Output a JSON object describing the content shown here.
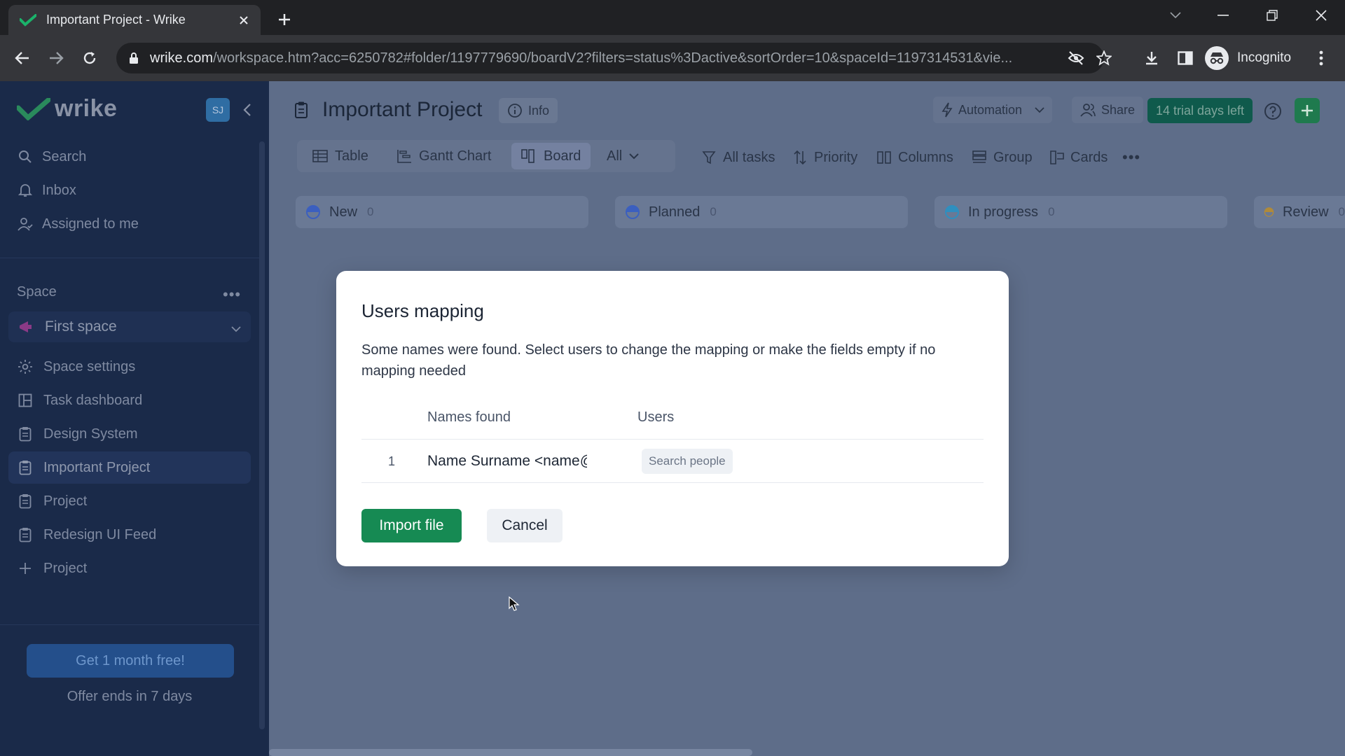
{
  "browser": {
    "tab_title": "Important Project - Wrike",
    "url_host": "wrike.com",
    "url_path": "/workspace.htm?acc=6250782#folder/1197779690/boardV2?filters=status%3Dactive&sortOrder=10&spaceId=1197314531&vie...",
    "profile_label": "Incognito"
  },
  "sidebar": {
    "logo_text": "wrike",
    "avatar_initials": "SJ",
    "nav": [
      {
        "label": "Search",
        "icon": "search-icon"
      },
      {
        "label": "Inbox",
        "icon": "bell-icon"
      },
      {
        "label": "Assigned to me",
        "icon": "user-icon"
      }
    ],
    "space_label": "Space",
    "space_more": "•••",
    "space_selected": "First space",
    "space_items": [
      {
        "label": "Space settings",
        "icon": "gear-icon"
      },
      {
        "label": "Task dashboard",
        "icon": "dashboard-icon"
      },
      {
        "label": "Design System",
        "icon": "project-icon"
      },
      {
        "label": "Important Project",
        "icon": "project-icon",
        "active": true
      },
      {
        "label": "Project",
        "icon": "project-icon"
      },
      {
        "label": "Redesign UI Feed",
        "icon": "project-icon"
      },
      {
        "label": "Project",
        "icon": "plus-icon"
      }
    ],
    "promo_button": "Get 1 month free!",
    "offer_text": "Offer ends in 7 days"
  },
  "header": {
    "title": "Important Project",
    "info_label": "Info",
    "automation_label": "Automation",
    "share_label": "Share",
    "trial_label": "14 trial days left"
  },
  "views": {
    "table": "Table",
    "gantt": "Gantt Chart",
    "board": "Board",
    "all": "All"
  },
  "tools": {
    "all_tasks": "All tasks",
    "priority": "Priority",
    "columns": "Columns",
    "group": "Group",
    "cards": "Cards",
    "more": "•••"
  },
  "columns": [
    {
      "label": "New",
      "count": "0",
      "color": "#3b5fbf"
    },
    {
      "label": "Planned",
      "count": "0",
      "color": "#3b5fbf"
    },
    {
      "label": "In progress",
      "count": "0",
      "color": "#2f8fbf"
    },
    {
      "label": "Review",
      "count": "0",
      "color": "#b08a3a"
    }
  ],
  "modal": {
    "title": "Users mapping",
    "description": "Some names were found. Select users to change the mapping or make the fields empty if no mapping needed",
    "col_names": "Names found",
    "col_users": "Users",
    "row_number": "1",
    "row_name": "Name Surname <name@company.com>",
    "search_placeholder": "Search people",
    "import_button": "Import file",
    "cancel_button": "Cancel"
  },
  "colors": {
    "accent_green": "#168a53",
    "sidebar_bg": "#1a2a49",
    "trial_bg": "#0f5a4c"
  }
}
